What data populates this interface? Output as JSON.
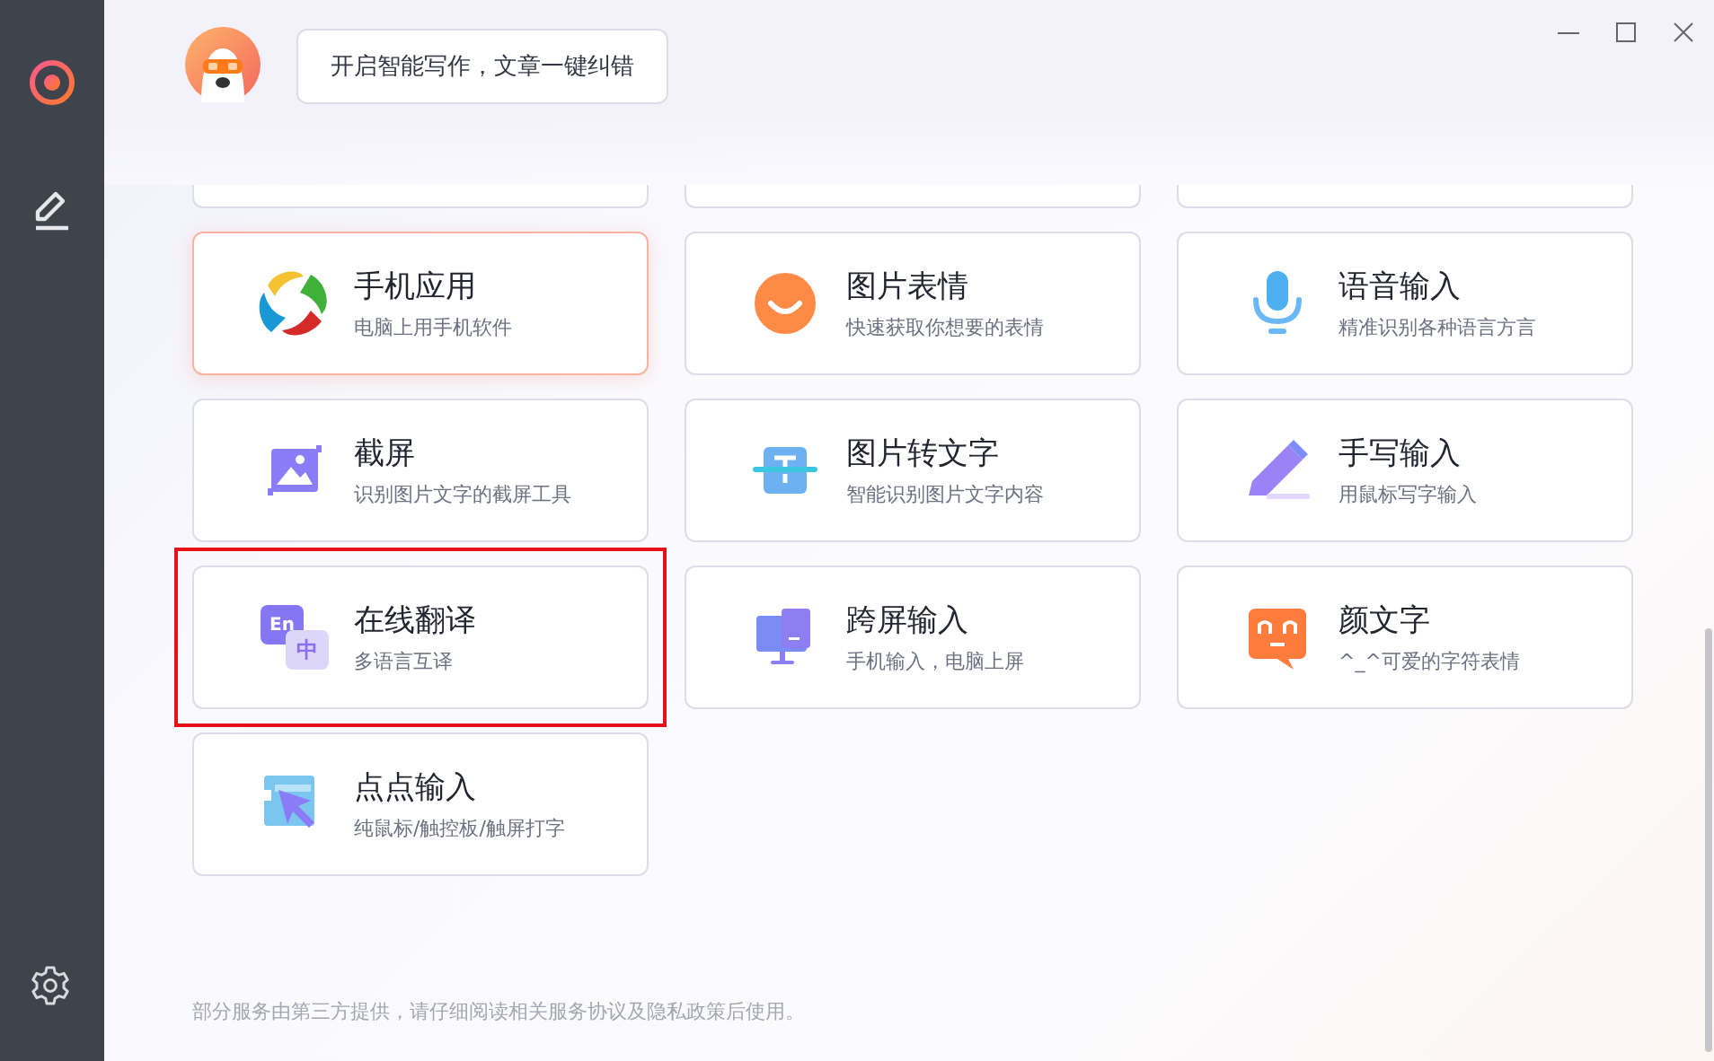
{
  "header": {
    "bubble": "开启智能写作，文章一键纠错"
  },
  "tools": [
    {
      "kind": "apps",
      "title": "手机应用",
      "subtitle": "电脑上用手机软件",
      "active": true,
      "highlighted": false
    },
    {
      "kind": "emoji",
      "title": "图片表情",
      "subtitle": "快速获取你想要的表情",
      "active": false,
      "highlighted": false
    },
    {
      "kind": "voice",
      "title": "语音输入",
      "subtitle": "精准识别各种语言方言",
      "active": false,
      "highlighted": false
    },
    {
      "kind": "screenshot",
      "title": "截屏",
      "subtitle": "识别图片文字的截屏工具",
      "active": false,
      "highlighted": false
    },
    {
      "kind": "ocr",
      "title": "图片转文字",
      "subtitle": "智能识别图片文字内容",
      "active": false,
      "highlighted": false
    },
    {
      "kind": "handwrite",
      "title": "手写输入",
      "subtitle": "用鼠标写字输入",
      "active": false,
      "highlighted": false
    },
    {
      "kind": "translate",
      "title": "在线翻译",
      "subtitle": "多语言互译",
      "active": false,
      "highlighted": true,
      "icon_labels": [
        "En",
        "中"
      ]
    },
    {
      "kind": "crossscreen",
      "title": "跨屏输入",
      "subtitle": "手机输入，电脑上屏",
      "active": false,
      "highlighted": false
    },
    {
      "kind": "kaomoji",
      "title": "颜文字",
      "subtitle": "^_^可爱的字符表情",
      "active": false,
      "highlighted": false
    },
    {
      "kind": "click",
      "title": "点点输入",
      "subtitle": "纯鼠标/触控板/触屏打字",
      "active": false,
      "highlighted": false
    }
  ],
  "footer": "部分服务由第三方提供，请仔细阅读相关服务协议及隐私政策后使用。"
}
